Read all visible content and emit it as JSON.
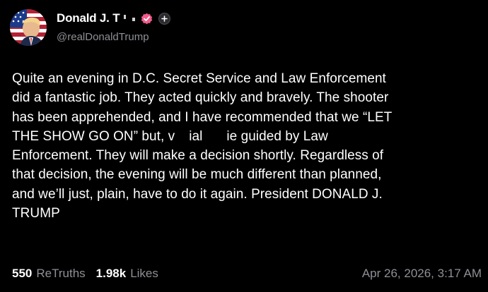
{
  "author": {
    "display_name": "Donald J. T",
    "handle": "@realDonaldTrump",
    "verified_badge_color": "#f05b8a"
  },
  "post": {
    "lines": [
      "Quite an evening in D.C. Secret Service and Law Enforcement",
      "did a fantastic job. They acted quickly and bravely. The shooter",
      "has been apprehended, and I have recommended that we “LET",
      "THE SHOW GO ON” but, v",
      "Enforcement. They will make a decision shortly. Regardless of",
      "that decision, the evening will be much different than planned,",
      "and we’ll just, plain, have to do it again. President DONALD J.",
      "TRUMP"
    ],
    "line4_fragments": [
      "THE SHOW GO ON” but, v",
      "ial",
      "ie guided by Law"
    ]
  },
  "stats": {
    "retruths_count": "550",
    "retruths_label": "ReTruths",
    "likes_count": "1.98k",
    "likes_label": "Likes"
  },
  "timestamp": "Apr 26, 2026, 3:17 AM",
  "icons": {
    "avatar": "avatar-flag-portrait",
    "verified": "verified-badge-icon",
    "follow": "plus-icon"
  },
  "colors": {
    "background": "#000000",
    "text": "#ffffff",
    "muted": "#8f8f96"
  }
}
